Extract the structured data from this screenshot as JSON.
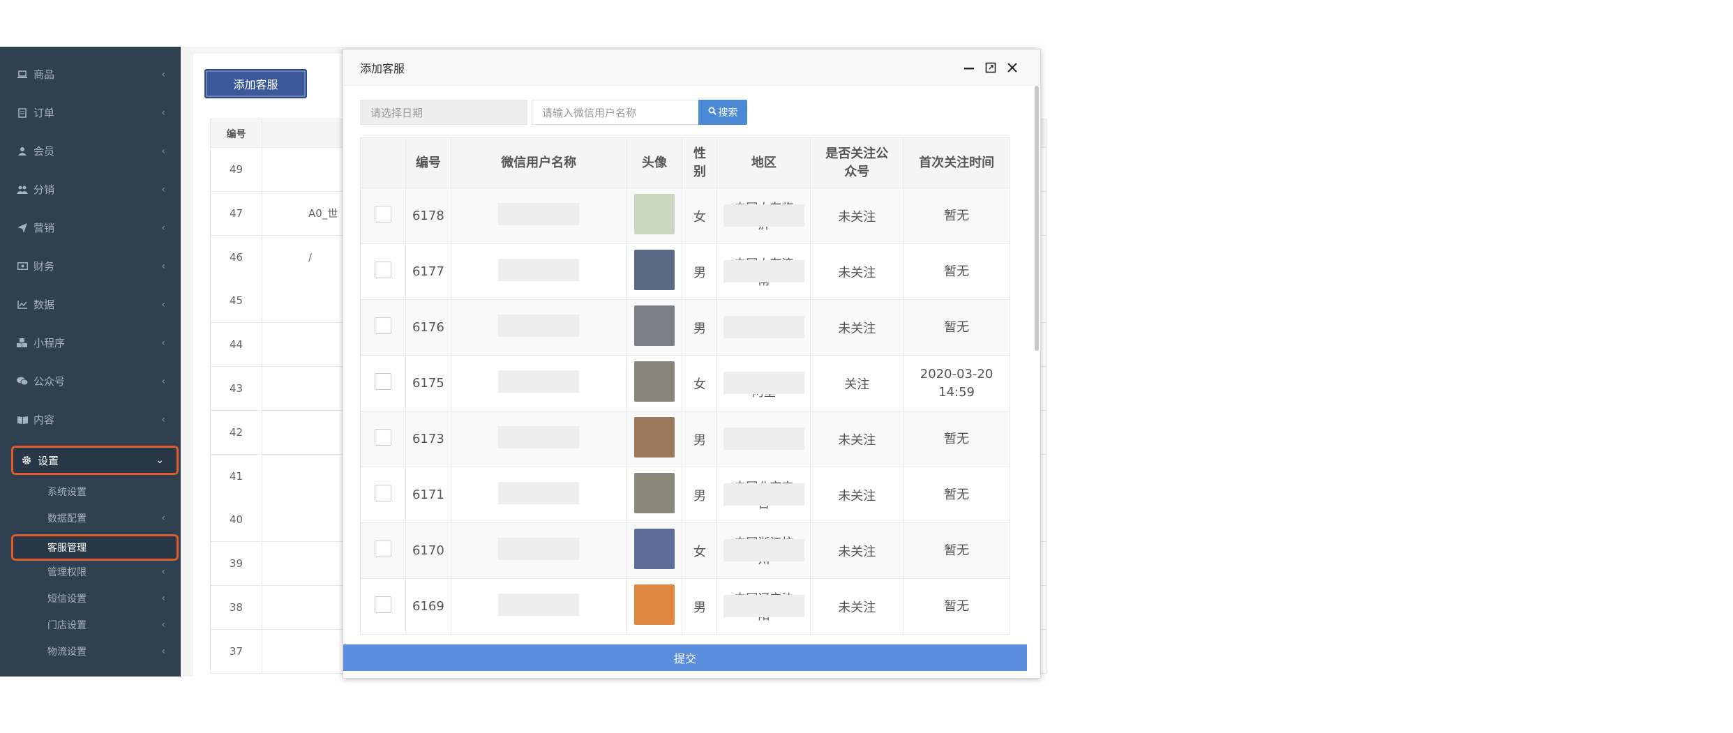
{
  "sidebar": {
    "items": [
      {
        "label": "商品",
        "icon": "laptop-icon"
      },
      {
        "label": "订单",
        "icon": "receipt-icon"
      },
      {
        "label": "会员",
        "icon": "user-icon"
      },
      {
        "label": "分销",
        "icon": "users-icon"
      },
      {
        "label": "营销",
        "icon": "paper-plane-icon"
      },
      {
        "label": "财务",
        "icon": "money-icon"
      },
      {
        "label": "数据",
        "icon": "line-chart-icon"
      },
      {
        "label": "小程序",
        "icon": "cubes-icon"
      },
      {
        "label": "公众号",
        "icon": "wechat-icon"
      },
      {
        "label": "内容",
        "icon": "book-icon"
      },
      {
        "label": "设置",
        "icon": "gear-icon"
      }
    ],
    "sub_items": [
      {
        "label": "系统设置"
      },
      {
        "label": "数据配置"
      },
      {
        "label": "客服管理"
      },
      {
        "label": "管理权限"
      },
      {
        "label": "短信设置"
      },
      {
        "label": "门店设置"
      },
      {
        "label": "物流设置"
      }
    ]
  },
  "background": {
    "add_button": "添加客服",
    "id_header": "编号",
    "rows": [
      {
        "id": "49",
        "name": ""
      },
      {
        "id": "47",
        "name": "A0_世"
      },
      {
        "id": "46",
        "name": "/"
      },
      {
        "id": "45",
        "name": ""
      },
      {
        "id": "44",
        "name": ""
      },
      {
        "id": "43",
        "name": ""
      },
      {
        "id": "42",
        "name": ""
      },
      {
        "id": "41",
        "name": ""
      },
      {
        "id": "40",
        "name": ""
      },
      {
        "id": "39",
        "name": ""
      },
      {
        "id": "38",
        "name": ""
      },
      {
        "id": "37",
        "name": ""
      }
    ]
  },
  "modal": {
    "title": "添加客服",
    "date_placeholder": "请选择日期",
    "name_placeholder": "请输入微信用户名称",
    "search_label": "搜索",
    "submit_label": "提交",
    "columns": [
      "",
      "编号",
      "微信用户名称",
      "头像",
      "性别",
      "地区",
      "是否关注公众号",
      "首次关注时间"
    ],
    "rows": [
      {
        "id": "6178",
        "gender": "女",
        "region": "中国山东临\n沂",
        "follow": "未关注",
        "first_time": "暂无",
        "avatar_color": "#c9d7c0"
      },
      {
        "id": "6177",
        "gender": "男",
        "region": "中国山东济\n南",
        "follow": "未关注",
        "first_time": "暂无",
        "avatar_color": "#5a6a86"
      },
      {
        "id": "6176",
        "gender": "男",
        "region": "",
        "follow": "未关注",
        "first_time": "暂无",
        "avatar_color": "#7a7e86"
      },
      {
        "id": "6175",
        "gender": "女",
        "region": "\n阿里",
        "follow": "关注",
        "first_time": "2020-03-20\n14:59",
        "avatar_color": "#8b8478"
      },
      {
        "id": "6173",
        "gender": "男",
        "region": "",
        "follow": "未关注",
        "first_time": "暂无",
        "avatar_color": "#9a7a5a"
      },
      {
        "id": "6171",
        "gender": "男",
        "region": "中国北京丰\n台",
        "follow": "未关注",
        "first_time": "暂无",
        "avatar_color": "#8a8a7a"
      },
      {
        "id": "6170",
        "gender": "女",
        "region": "中国浙江杭\n州",
        "follow": "未关注",
        "first_time": "暂无",
        "avatar_color": "#5e6e9a"
      },
      {
        "id": "6169",
        "gender": "男",
        "region": "中国辽宁沈\n阳",
        "follow": "未关注",
        "first_time": "暂无",
        "avatar_color": "#e0863f"
      }
    ]
  }
}
